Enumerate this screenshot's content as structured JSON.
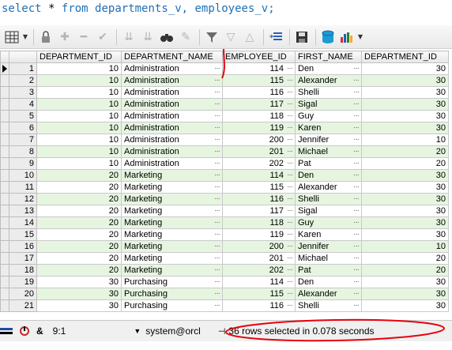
{
  "editor": {
    "sql_select": "select",
    "sql_star": "*",
    "sql_from": "from",
    "sql_table1": "departments_v,",
    "sql_table2": "employees_v;"
  },
  "toolbar": {
    "icons": [
      "grid-icon",
      "lock-icon",
      "add-icon",
      "remove-icon",
      "check-icon",
      "first-icon",
      "last-icon",
      "binoculars-icon",
      "eraser-icon",
      "filter-icon",
      "down-icon",
      "up-icon",
      "sort-icon",
      "save-icon",
      "db-icon",
      "chart-icon"
    ]
  },
  "grid": {
    "columns": [
      "DEPARTMENT_ID",
      "DEPARTMENT_NAME",
      "EMPLOYEE_ID",
      "FIRST_NAME",
      "DEPARTMENT_ID"
    ],
    "rows": [
      {
        "n": "1",
        "dept": "10",
        "name": "Administration",
        "emp": "114",
        "first": "Den",
        "dept2": "30"
      },
      {
        "n": "2",
        "dept": "10",
        "name": "Administration",
        "emp": "115",
        "first": "Alexander",
        "dept2": "30"
      },
      {
        "n": "3",
        "dept": "10",
        "name": "Administration",
        "emp": "116",
        "first": "Shelli",
        "dept2": "30"
      },
      {
        "n": "4",
        "dept": "10",
        "name": "Administration",
        "emp": "117",
        "first": "Sigal",
        "dept2": "30"
      },
      {
        "n": "5",
        "dept": "10",
        "name": "Administration",
        "emp": "118",
        "first": "Guy",
        "dept2": "30"
      },
      {
        "n": "6",
        "dept": "10",
        "name": "Administration",
        "emp": "119",
        "first": "Karen",
        "dept2": "30"
      },
      {
        "n": "7",
        "dept": "10",
        "name": "Administration",
        "emp": "200",
        "first": "Jennifer",
        "dept2": "10"
      },
      {
        "n": "8",
        "dept": "10",
        "name": "Administration",
        "emp": "201",
        "first": "Michael",
        "dept2": "20"
      },
      {
        "n": "9",
        "dept": "10",
        "name": "Administration",
        "emp": "202",
        "first": "Pat",
        "dept2": "20"
      },
      {
        "n": "10",
        "dept": "20",
        "name": "Marketing",
        "emp": "114",
        "first": "Den",
        "dept2": "30"
      },
      {
        "n": "11",
        "dept": "20",
        "name": "Marketing",
        "emp": "115",
        "first": "Alexander",
        "dept2": "30"
      },
      {
        "n": "12",
        "dept": "20",
        "name": "Marketing",
        "emp": "116",
        "first": "Shelli",
        "dept2": "30"
      },
      {
        "n": "13",
        "dept": "20",
        "name": "Marketing",
        "emp": "117",
        "first": "Sigal",
        "dept2": "30"
      },
      {
        "n": "14",
        "dept": "20",
        "name": "Marketing",
        "emp": "118",
        "first": "Guy",
        "dept2": "30"
      },
      {
        "n": "15",
        "dept": "20",
        "name": "Marketing",
        "emp": "119",
        "first": "Karen",
        "dept2": "30"
      },
      {
        "n": "16",
        "dept": "20",
        "name": "Marketing",
        "emp": "200",
        "first": "Jennifer",
        "dept2": "10"
      },
      {
        "n": "17",
        "dept": "20",
        "name": "Marketing",
        "emp": "201",
        "first": "Michael",
        "dept2": "20"
      },
      {
        "n": "18",
        "dept": "20",
        "name": "Marketing",
        "emp": "202",
        "first": "Pat",
        "dept2": "20"
      },
      {
        "n": "19",
        "dept": "30",
        "name": "Purchasing",
        "emp": "114",
        "first": "Den",
        "dept2": "30"
      },
      {
        "n": "20",
        "dept": "30",
        "name": "Purchasing",
        "emp": "115",
        "first": "Alexander",
        "dept2": "30"
      },
      {
        "n": "21",
        "dept": "30",
        "name": "Purchasing",
        "emp": "116",
        "first": "Shelli",
        "dept2": "30"
      }
    ]
  },
  "status": {
    "cursor_pos": "9:1",
    "connection": "system@orcl",
    "message": "36 rows selected in 0.078 seconds"
  },
  "colors": {
    "alt_row": "#e6f5e0",
    "annotation": "#e8000b",
    "sql_keyword": "#1f6fb5"
  }
}
